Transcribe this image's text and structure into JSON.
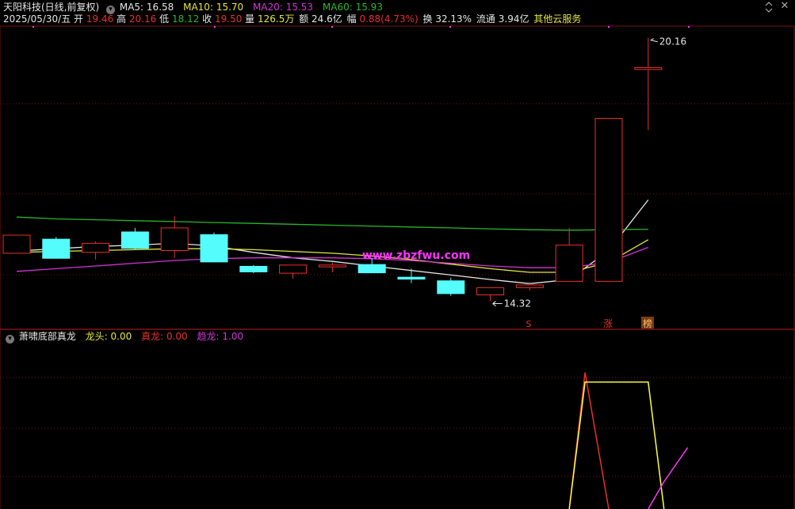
{
  "header": {
    "stock": "天阳科技(日线,前复权)",
    "ma5_label": "MA5:",
    "ma5": "16.58",
    "ma10_label": "MA10:",
    "ma10": "15.70",
    "ma20_label": "MA20:",
    "ma20": "15.53",
    "ma60_label": "MA60:",
    "ma60": "15.93",
    "date": "2025/05/30/五",
    "open_label": "开",
    "open": "19.46",
    "high_label": "高",
    "high": "20.16",
    "low_label": "低",
    "low": "18.12",
    "close_label": "收",
    "close": "19.50",
    "vol_label": "量",
    "vol": "126.5万",
    "amt_label": "额",
    "amt": "24.6亿",
    "chg_label": "幅",
    "chg": "0.88(4.73%)",
    "turn_label": "换",
    "turn": "32.13%",
    "float_label": "流通",
    "float": "3.94亿",
    "other": "其他云服务"
  },
  "colors": {
    "up": "#e8302a",
    "down": "#54fcfc",
    "ma5": "#e6e6e6",
    "ma10": "#e6e640",
    "ma20": "#d433d4",
    "ma60": "#28b828",
    "grid": "#7a1010",
    "white": "#e6e6e6",
    "magenta": "#ff33ff",
    "yellow": "#ffff40"
  },
  "watermark": "www.zbzfwu.com",
  "markers": {
    "s": "S",
    "zhang": "涨",
    "bang": "榜"
  },
  "chart_data": [
    {
      "type": "candlestick",
      "title": "天阳科技(日线,前复权)",
      "ylim": [
        14.0,
        20.4
      ],
      "candles": [
        {
          "open": 15.4,
          "close": 15.8,
          "high": 15.8,
          "low": 15.4
        },
        {
          "open": 15.72,
          "close": 15.28,
          "high": 15.76,
          "low": 15.28
        },
        {
          "open": 15.42,
          "close": 15.62,
          "high": 15.66,
          "low": 15.26
        },
        {
          "open": 15.88,
          "close": 15.5,
          "high": 15.96,
          "low": 15.48
        },
        {
          "open": 15.46,
          "close": 15.96,
          "high": 16.22,
          "low": 15.3
        },
        {
          "open": 15.82,
          "close": 15.2,
          "high": 15.86,
          "low": 15.2
        },
        {
          "open": 15.12,
          "close": 14.98,
          "high": 15.14,
          "low": 14.96
        },
        {
          "open": 14.96,
          "close": 15.14,
          "high": 15.14,
          "low": 14.84
        },
        {
          "open": 15.1,
          "close": 15.14,
          "high": 15.2,
          "low": 14.98
        },
        {
          "open": 15.16,
          "close": 14.96,
          "high": 15.3,
          "low": 14.96
        },
        {
          "open": 14.88,
          "close": 14.82,
          "high": 15.06,
          "low": 14.74
        },
        {
          "open": 14.8,
          "close": 14.5,
          "high": 14.86,
          "low": 14.46
        },
        {
          "open": 14.48,
          "close": 14.64,
          "high": 14.64,
          "low": 14.34
        },
        {
          "open": 14.64,
          "close": 14.7,
          "high": 14.76,
          "low": 14.58
        },
        {
          "open": 14.78,
          "close": 15.58,
          "high": 15.96,
          "low": 14.78
        },
        {
          "open": 14.78,
          "close": 18.38,
          "high": 18.38,
          "low": 14.78
        },
        {
          "open": 19.46,
          "close": 19.5,
          "high": 20.16,
          "low": 18.12
        }
      ],
      "series": [
        {
          "name": "MA5",
          "values": [
            15.45,
            15.5,
            15.55,
            15.58,
            15.62,
            15.56,
            15.42,
            15.3,
            15.22,
            15.12,
            15.02,
            14.92,
            14.82,
            14.73,
            14.82,
            15.46,
            16.58
          ]
        },
        {
          "name": "MA10",
          "values": [
            15.42,
            15.44,
            15.46,
            15.48,
            15.5,
            15.5,
            15.48,
            15.44,
            15.4,
            15.34,
            15.26,
            15.16,
            15.06,
            14.98,
            14.98,
            15.2,
            15.7
          ]
        },
        {
          "name": "MA20",
          "values": [
            15.0,
            15.06,
            15.12,
            15.18,
            15.24,
            15.28,
            15.3,
            15.3,
            15.3,
            15.28,
            15.24,
            15.18,
            15.12,
            15.08,
            15.08,
            15.2,
            15.53
          ]
        },
        {
          "name": "MA60",
          "values": [
            16.2,
            16.16,
            16.14,
            16.12,
            16.1,
            16.08,
            16.06,
            16.04,
            16.02,
            16.0,
            15.98,
            15.96,
            15.94,
            15.92,
            15.91,
            15.92,
            15.93
          ]
        }
      ],
      "annotations": {
        "max_label": "20.16",
        "min_label": "14.32"
      }
    },
    {
      "type": "line",
      "title": "萧啸底部真龙",
      "items": [
        {
          "name": "龙头",
          "value": "0.00"
        },
        {
          "name": "真龙",
          "value": "0.00"
        },
        {
          "name": "趋龙",
          "value": "1.00"
        }
      ],
      "ylim": [
        0,
        1.2
      ],
      "x": [
        13.3,
        14,
        14.4,
        15,
        15.5,
        16,
        16.4,
        17
      ],
      "series": [
        {
          "name": "真龙",
          "values": [
            null,
            0.0,
            1.0,
            0.0,
            null,
            null,
            null,
            null
          ]
        },
        {
          "name": "龙头",
          "values": [
            null,
            0.0,
            0.93,
            0.93,
            0.93,
            0.93,
            0.0,
            null
          ]
        },
        {
          "name": "趋龙",
          "values": [
            null,
            null,
            null,
            null,
            null,
            0.0,
            0.2,
            0.45
          ]
        }
      ]
    }
  ]
}
